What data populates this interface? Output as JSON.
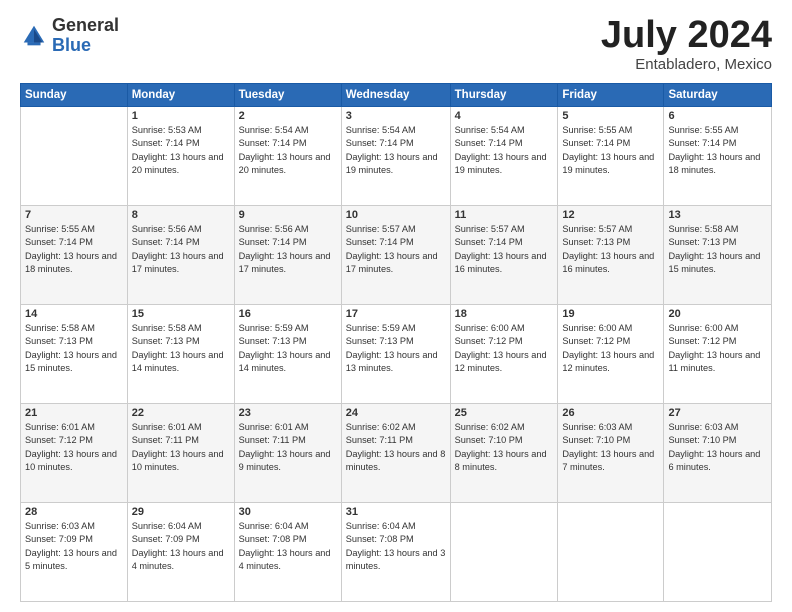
{
  "header": {
    "logo_general": "General",
    "logo_blue": "Blue",
    "month_title": "July 2024",
    "location": "Entabladero, Mexico"
  },
  "weekdays": [
    "Sunday",
    "Monday",
    "Tuesday",
    "Wednesday",
    "Thursday",
    "Friday",
    "Saturday"
  ],
  "weeks": [
    [
      {
        "day": "",
        "sunrise": "",
        "sunset": "",
        "daylight": ""
      },
      {
        "day": "1",
        "sunrise": "Sunrise: 5:53 AM",
        "sunset": "Sunset: 7:14 PM",
        "daylight": "Daylight: 13 hours and 20 minutes."
      },
      {
        "day": "2",
        "sunrise": "Sunrise: 5:54 AM",
        "sunset": "Sunset: 7:14 PM",
        "daylight": "Daylight: 13 hours and 20 minutes."
      },
      {
        "day": "3",
        "sunrise": "Sunrise: 5:54 AM",
        "sunset": "Sunset: 7:14 PM",
        "daylight": "Daylight: 13 hours and 19 minutes."
      },
      {
        "day": "4",
        "sunrise": "Sunrise: 5:54 AM",
        "sunset": "Sunset: 7:14 PM",
        "daylight": "Daylight: 13 hours and 19 minutes."
      },
      {
        "day": "5",
        "sunrise": "Sunrise: 5:55 AM",
        "sunset": "Sunset: 7:14 PM",
        "daylight": "Daylight: 13 hours and 19 minutes."
      },
      {
        "day": "6",
        "sunrise": "Sunrise: 5:55 AM",
        "sunset": "Sunset: 7:14 PM",
        "daylight": "Daylight: 13 hours and 18 minutes."
      }
    ],
    [
      {
        "day": "7",
        "sunrise": "Sunrise: 5:55 AM",
        "sunset": "Sunset: 7:14 PM",
        "daylight": "Daylight: 13 hours and 18 minutes."
      },
      {
        "day": "8",
        "sunrise": "Sunrise: 5:56 AM",
        "sunset": "Sunset: 7:14 PM",
        "daylight": "Daylight: 13 hours and 17 minutes."
      },
      {
        "day": "9",
        "sunrise": "Sunrise: 5:56 AM",
        "sunset": "Sunset: 7:14 PM",
        "daylight": "Daylight: 13 hours and 17 minutes."
      },
      {
        "day": "10",
        "sunrise": "Sunrise: 5:57 AM",
        "sunset": "Sunset: 7:14 PM",
        "daylight": "Daylight: 13 hours and 17 minutes."
      },
      {
        "day": "11",
        "sunrise": "Sunrise: 5:57 AM",
        "sunset": "Sunset: 7:14 PM",
        "daylight": "Daylight: 13 hours and 16 minutes."
      },
      {
        "day": "12",
        "sunrise": "Sunrise: 5:57 AM",
        "sunset": "Sunset: 7:13 PM",
        "daylight": "Daylight: 13 hours and 16 minutes."
      },
      {
        "day": "13",
        "sunrise": "Sunrise: 5:58 AM",
        "sunset": "Sunset: 7:13 PM",
        "daylight": "Daylight: 13 hours and 15 minutes."
      }
    ],
    [
      {
        "day": "14",
        "sunrise": "Sunrise: 5:58 AM",
        "sunset": "Sunset: 7:13 PM",
        "daylight": "Daylight: 13 hours and 15 minutes."
      },
      {
        "day": "15",
        "sunrise": "Sunrise: 5:58 AM",
        "sunset": "Sunset: 7:13 PM",
        "daylight": "Daylight: 13 hours and 14 minutes."
      },
      {
        "day": "16",
        "sunrise": "Sunrise: 5:59 AM",
        "sunset": "Sunset: 7:13 PM",
        "daylight": "Daylight: 13 hours and 14 minutes."
      },
      {
        "day": "17",
        "sunrise": "Sunrise: 5:59 AM",
        "sunset": "Sunset: 7:13 PM",
        "daylight": "Daylight: 13 hours and 13 minutes."
      },
      {
        "day": "18",
        "sunrise": "Sunrise: 6:00 AM",
        "sunset": "Sunset: 7:12 PM",
        "daylight": "Daylight: 13 hours and 12 minutes."
      },
      {
        "day": "19",
        "sunrise": "Sunrise: 6:00 AM",
        "sunset": "Sunset: 7:12 PM",
        "daylight": "Daylight: 13 hours and 12 minutes."
      },
      {
        "day": "20",
        "sunrise": "Sunrise: 6:00 AM",
        "sunset": "Sunset: 7:12 PM",
        "daylight": "Daylight: 13 hours and 11 minutes."
      }
    ],
    [
      {
        "day": "21",
        "sunrise": "Sunrise: 6:01 AM",
        "sunset": "Sunset: 7:12 PM",
        "daylight": "Daylight: 13 hours and 10 minutes."
      },
      {
        "day": "22",
        "sunrise": "Sunrise: 6:01 AM",
        "sunset": "Sunset: 7:11 PM",
        "daylight": "Daylight: 13 hours and 10 minutes."
      },
      {
        "day": "23",
        "sunrise": "Sunrise: 6:01 AM",
        "sunset": "Sunset: 7:11 PM",
        "daylight": "Daylight: 13 hours and 9 minutes."
      },
      {
        "day": "24",
        "sunrise": "Sunrise: 6:02 AM",
        "sunset": "Sunset: 7:11 PM",
        "daylight": "Daylight: 13 hours and 8 minutes."
      },
      {
        "day": "25",
        "sunrise": "Sunrise: 6:02 AM",
        "sunset": "Sunset: 7:10 PM",
        "daylight": "Daylight: 13 hours and 8 minutes."
      },
      {
        "day": "26",
        "sunrise": "Sunrise: 6:03 AM",
        "sunset": "Sunset: 7:10 PM",
        "daylight": "Daylight: 13 hours and 7 minutes."
      },
      {
        "day": "27",
        "sunrise": "Sunrise: 6:03 AM",
        "sunset": "Sunset: 7:10 PM",
        "daylight": "Daylight: 13 hours and 6 minutes."
      }
    ],
    [
      {
        "day": "28",
        "sunrise": "Sunrise: 6:03 AM",
        "sunset": "Sunset: 7:09 PM",
        "daylight": "Daylight: 13 hours and 5 minutes."
      },
      {
        "day": "29",
        "sunrise": "Sunrise: 6:04 AM",
        "sunset": "Sunset: 7:09 PM",
        "daylight": "Daylight: 13 hours and 4 minutes."
      },
      {
        "day": "30",
        "sunrise": "Sunrise: 6:04 AM",
        "sunset": "Sunset: 7:08 PM",
        "daylight": "Daylight: 13 hours and 4 minutes."
      },
      {
        "day": "31",
        "sunrise": "Sunrise: 6:04 AM",
        "sunset": "Sunset: 7:08 PM",
        "daylight": "Daylight: 13 hours and 3 minutes."
      },
      {
        "day": "",
        "sunrise": "",
        "sunset": "",
        "daylight": ""
      },
      {
        "day": "",
        "sunrise": "",
        "sunset": "",
        "daylight": ""
      },
      {
        "day": "",
        "sunrise": "",
        "sunset": "",
        "daylight": ""
      }
    ]
  ]
}
